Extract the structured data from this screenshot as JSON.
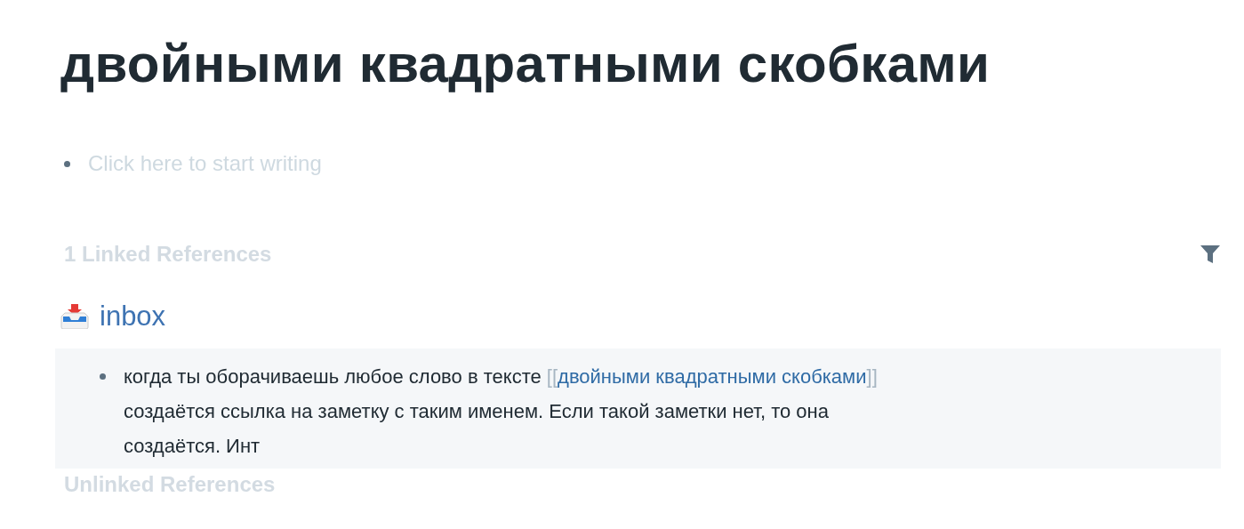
{
  "page_title": "двойными квадратными скобками",
  "empty_block": {
    "placeholder": "Click here to start writing"
  },
  "linked_references": {
    "heading": "1 Linked References",
    "groups": [
      {
        "page": "inbox",
        "blocks": [
          {
            "text_before": "когда ты оборачиваешь любое слово в тексте",
            "link_open": "[[",
            "link": "двойными квадратными скобками",
            "link_close": "]]",
            "text_after": "создаётся ссылка на заметку с таким именем. Если такой заметки нет, то она создаётся. Инт"
          }
        ]
      }
    ]
  },
  "unlinked_references": {
    "heading": "Unlinked References"
  }
}
